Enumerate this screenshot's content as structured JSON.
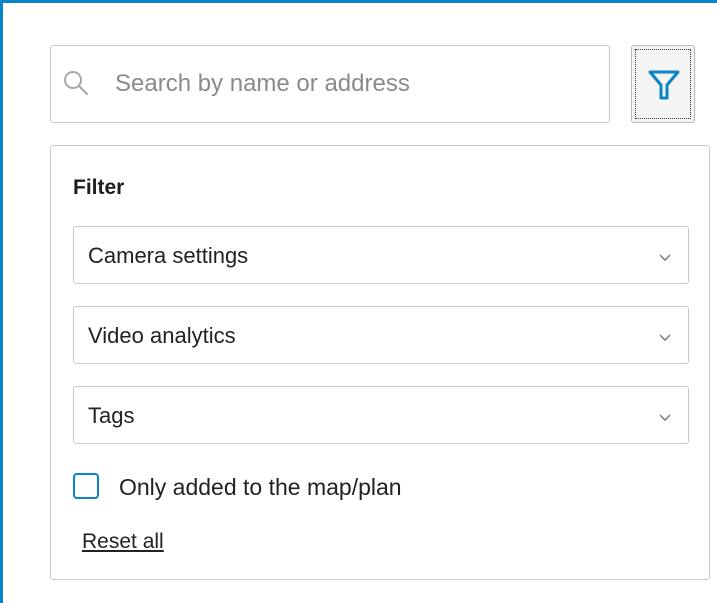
{
  "search": {
    "placeholder": "Search by name or address",
    "icon": "search-icon"
  },
  "filter_button": {
    "icon": "funnel-icon",
    "icon_color": "#0a84c6"
  },
  "filter_panel": {
    "title": "Filter",
    "dropdowns": [
      {
        "label": "Camera settings"
      },
      {
        "label": "Video analytics"
      },
      {
        "label": "Tags"
      }
    ],
    "checkbox": {
      "label": "Only added to the map/plan",
      "checked": false
    },
    "reset_label": "Reset all"
  },
  "colors": {
    "accent": "#0a84c6",
    "border": "#c9c9c9"
  }
}
